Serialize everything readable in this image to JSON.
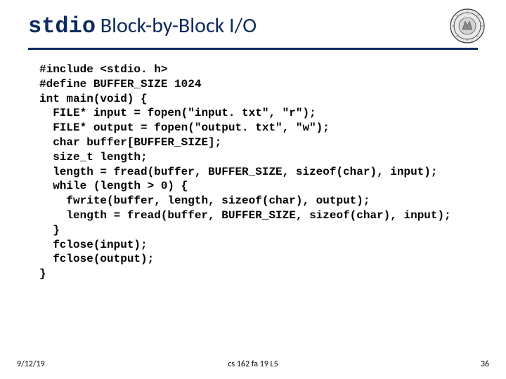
{
  "title": {
    "mono": "stdio",
    "rest": " Block-by-Block I/O"
  },
  "code": "#include <stdio. h>\n#define BUFFER_SIZE 1024\nint main(void) {\n  FILE* input = fopen(\"input. txt\", \"r\");\n  FILE* output = fopen(\"output. txt\", \"w\");\n  char buffer[BUFFER_SIZE];\n  size_t length;\n  length = fread(buffer, BUFFER_SIZE, sizeof(char), input);\n  while (length > 0) {\n    fwrite(buffer, length, sizeof(char), output);\n    length = fread(buffer, BUFFER_SIZE, sizeof(char), input);\n  }\n  fclose(input);\n  fclose(output);\n}",
  "footer": {
    "date": "9/12/19",
    "center": "cs 162 fa 19 L5",
    "page": "36"
  }
}
